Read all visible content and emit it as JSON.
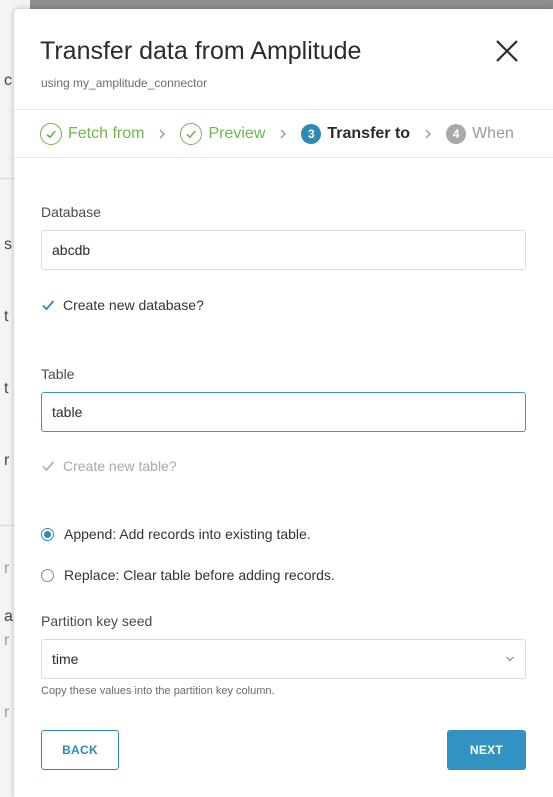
{
  "background": {
    "letters": [
      "c",
      "s",
      "t",
      "t",
      "r",
      "r",
      "a",
      "r",
      "r"
    ]
  },
  "dialog": {
    "title": "Transfer data from Amplitude",
    "subtitle": "using my_amplitude_connector",
    "close_icon": "close-icon"
  },
  "stepper": {
    "steps": [
      {
        "label": "Fetch from",
        "state": "done",
        "icon": "check-circle-icon"
      },
      {
        "label": "Preview",
        "state": "done",
        "icon": "check-circle-icon"
      },
      {
        "number": "3",
        "label": "Transfer to",
        "state": "active"
      },
      {
        "number": "4",
        "label": "When",
        "state": "pending"
      }
    ],
    "separator_icon": "chevron-right-icon"
  },
  "form": {
    "database_label": "Database",
    "database_value": "abcdb",
    "create_db_label": "Create new database?",
    "create_db_checked": true,
    "table_label": "Table",
    "table_value": "table",
    "create_table_label": "Create new table?",
    "create_table_checked": true,
    "create_table_disabled": true,
    "mode_options": [
      {
        "label": "Append: Add records into existing table.",
        "selected": true
      },
      {
        "label": "Replace: Clear table before adding records.",
        "selected": false
      }
    ],
    "partition_label": "Partition key seed",
    "partition_value": "time",
    "partition_helper": "Copy these values into the partition key column."
  },
  "buttons": {
    "back": "BACK",
    "next": "NEXT"
  },
  "colors": {
    "accent": "#2e8ab5",
    "success": "#6bb84e",
    "muted": "#a9a9a9"
  }
}
